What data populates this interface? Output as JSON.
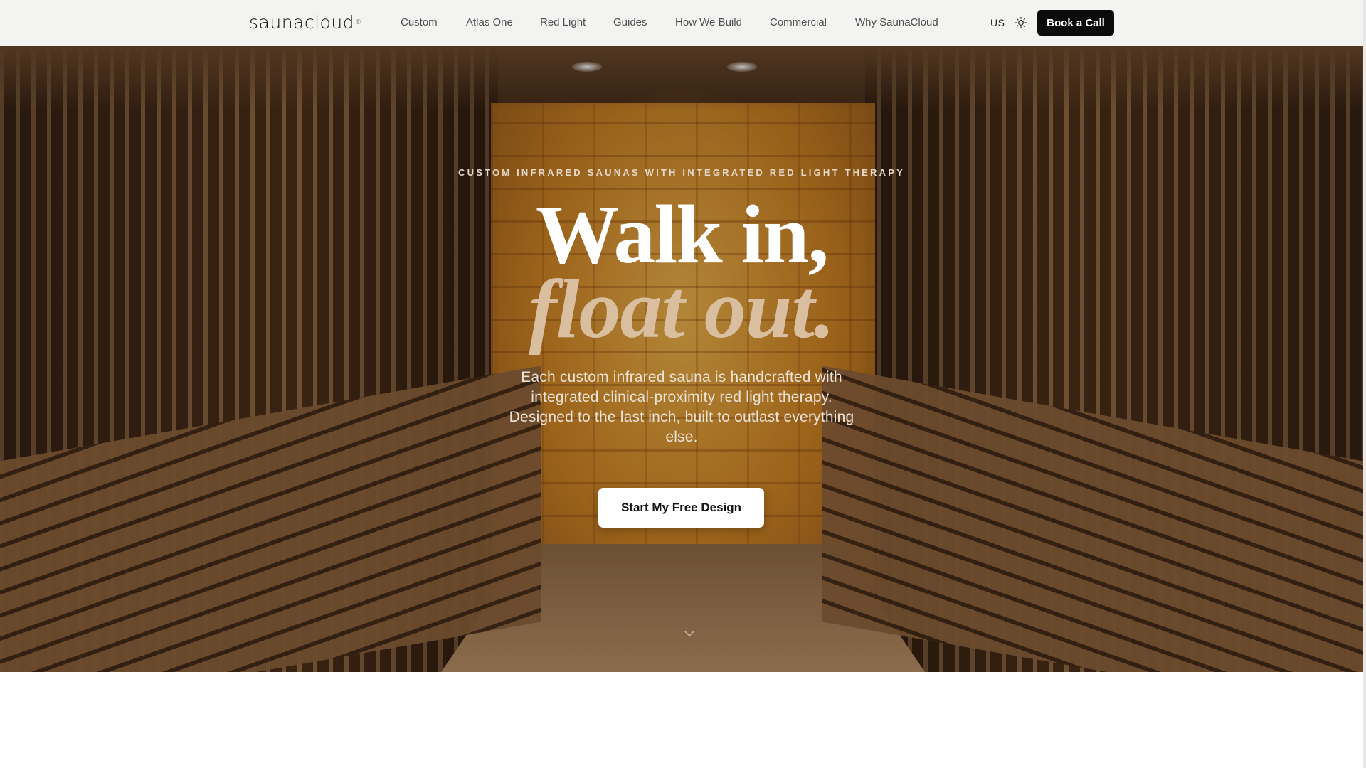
{
  "brand": {
    "logo_text": "saunacloud",
    "trademark": "®"
  },
  "nav": {
    "links": [
      {
        "label": "Custom"
      },
      {
        "label": "Atlas One"
      },
      {
        "label": "Red Light"
      },
      {
        "label": "Guides"
      },
      {
        "label": "How We Build"
      },
      {
        "label": "Commercial"
      },
      {
        "label": "Why SaunaCloud"
      }
    ],
    "region": "US",
    "theme_icon": "sun-icon",
    "book_label": "Book a Call"
  },
  "hero": {
    "eyebrow": "CUSTOM INFRARED SAUNAS WITH INTEGRATED RED LIGHT THERAPY",
    "headline_line1": "Walk in,",
    "headline_line2": "float out.",
    "subtext": "Each custom infrared sauna is handcrafted with integrated clinical-proximity red light therapy. Designed to the last inch, built to outlast everything else.",
    "cta_label": "Start My Free Design",
    "scroll_icon": "chevron-down-icon"
  },
  "colors": {
    "nav_bg": "#f3f3f2",
    "button_dark": "#0b0b0b",
    "headline_accent": "#d9bfa0",
    "cta_bg": "#ffffff"
  }
}
